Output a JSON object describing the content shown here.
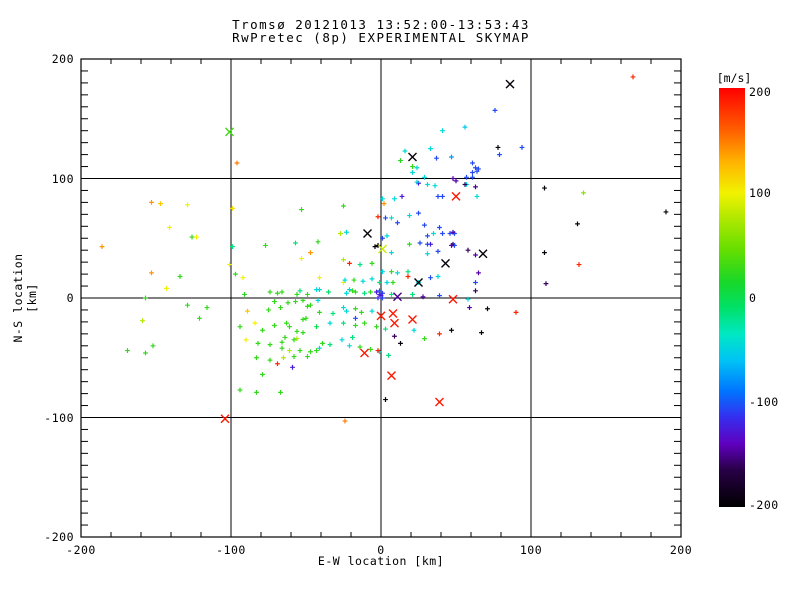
{
  "title": {
    "line1": "Tromsø 20121013 13:52:00-13:53:43",
    "line2": "RwPretec (8p) EXPERIMENTAL SKYMAP"
  },
  "axes": {
    "xlabel": "E-W location [km]",
    "ylabel": "N-S location [km]",
    "x_range": [
      -200,
      200
    ],
    "y_range": [
      -200,
      200
    ],
    "x_major_ticks": [
      -200,
      -100,
      0,
      100,
      200
    ],
    "y_major_ticks": [
      -200,
      -100,
      0,
      100,
      200
    ],
    "x_minor_step": 20,
    "y_minor_step": 10,
    "grid_at": [
      -100,
      0,
      100
    ],
    "frame_color": "#000000"
  },
  "colorbar": {
    "label": "[m/s]",
    "ticks": [
      200,
      100,
      0,
      -100,
      -200
    ],
    "range": [
      -200,
      200
    ]
  },
  "chart_data": {
    "type": "scatter",
    "title": "Tromsø 20121013 13:52:00-13:53:43 / RwPretec (8p) EXPERIMENTAL SKYMAP",
    "xlabel": "E-W location [km]",
    "ylabel": "N-S location [km]",
    "xlim": [
      -200,
      200
    ],
    "ylim": [
      -200,
      200
    ],
    "value_unit": "m/s",
    "value_range": [
      -200,
      200
    ],
    "colormap_stops": [
      [
        -200,
        0,
        0,
        0
      ],
      [
        -165,
        40,
        0,
        70
      ],
      [
        -140,
        95,
        0,
        190
      ],
      [
        -115,
        55,
        45,
        238
      ],
      [
        -90,
        0,
        115,
        255
      ],
      [
        -60,
        0,
        195,
        245
      ],
      [
        -35,
        0,
        232,
        195
      ],
      [
        -10,
        0,
        225,
        105
      ],
      [
        15,
        25,
        215,
        40
      ],
      [
        45,
        100,
        222,
        0
      ],
      [
        75,
        175,
        232,
        0
      ],
      [
        100,
        242,
        242,
        0
      ],
      [
        130,
        255,
        178,
        0
      ],
      [
        160,
        255,
        95,
        0
      ],
      [
        200,
        255,
        0,
        0
      ]
    ],
    "points_format": [
      "x_km",
      "y_km",
      "velocity_mps"
    ],
    "points": [
      [
        76,
        157,
        -105
      ],
      [
        56,
        143,
        -55
      ],
      [
        41,
        140,
        -45
      ],
      [
        16,
        123,
        -45
      ],
      [
        33,
        125,
        -45
      ],
      [
        37,
        117,
        -105
      ],
      [
        47,
        118,
        -75
      ],
      [
        13,
        115,
        20
      ],
      [
        78,
        126,
        -195
      ],
      [
        94,
        126,
        -105
      ],
      [
        79,
        120,
        -105
      ],
      [
        21,
        110,
        25
      ],
      [
        24,
        109,
        -45
      ],
      [
        21,
        105,
        -45
      ],
      [
        61,
        113,
        -105
      ],
      [
        63,
        109,
        -105
      ],
      [
        65,
        108,
        -105
      ],
      [
        61,
        101,
        -105
      ],
      [
        48,
        100,
        -145
      ],
      [
        57,
        101,
        -105
      ],
      [
        29,
        101,
        -45
      ],
      [
        25,
        96,
        -125
      ],
      [
        31,
        95,
        -45
      ],
      [
        36,
        94,
        -45
      ],
      [
        57,
        95,
        -45
      ],
      [
        38,
        85,
        -105
      ],
      [
        41,
        85,
        -105
      ],
      [
        63,
        93,
        -150
      ],
      [
        64,
        85,
        -45
      ],
      [
        64,
        106,
        -105
      ],
      [
        61,
        105,
        -105
      ],
      [
        24,
        97,
        -45
      ],
      [
        50,
        98,
        -145
      ],
      [
        56,
        95,
        -160
      ],
      [
        14,
        85,
        -125
      ],
      [
        9,
        83,
        -45
      ],
      [
        1,
        83,
        -45
      ],
      [
        25,
        71,
        -105
      ],
      [
        19,
        69,
        -45
      ],
      [
        29,
        61,
        -105
      ],
      [
        39,
        59,
        -105
      ],
      [
        3,
        67,
        -105
      ],
      [
        7,
        67,
        -45
      ],
      [
        11,
        63,
        -105
      ],
      [
        4,
        52,
        -45
      ],
      [
        1,
        50,
        -105
      ],
      [
        31,
        52,
        -105
      ],
      [
        33,
        45,
        -125
      ],
      [
        49,
        54,
        -105
      ],
      [
        48,
        45,
        -160
      ],
      [
        -2,
        44,
        -195
      ],
      [
        -25,
        77,
        25
      ],
      [
        -27,
        54,
        75
      ],
      [
        -2,
        68,
        185
      ],
      [
        2,
        79,
        140
      ],
      [
        35,
        54,
        -45
      ],
      [
        41,
        54,
        -105
      ],
      [
        46,
        54,
        -105
      ],
      [
        48,
        55,
        -145
      ],
      [
        49,
        44,
        -105
      ],
      [
        47,
        44,
        -145
      ],
      [
        63,
        13,
        -105
      ],
      [
        63,
        6,
        -160
      ],
      [
        65,
        21,
        -145
      ],
      [
        59,
        -8,
        -145
      ],
      [
        71,
        -9,
        -195
      ],
      [
        67,
        -29,
        -195
      ],
      [
        90,
        -12,
        185
      ],
      [
        110,
        12,
        -160
      ],
      [
        132,
        28,
        185
      ],
      [
        109,
        38,
        -195
      ],
      [
        131,
        62,
        -195
      ],
      [
        190,
        72,
        -195
      ],
      [
        135,
        88,
        60
      ],
      [
        109,
        92,
        -195
      ],
      [
        168,
        185,
        185
      ],
      [
        -96,
        113,
        150
      ],
      [
        -101,
        28,
        100
      ],
      [
        -4,
        43,
        -195
      ],
      [
        7,
        38,
        -45
      ],
      [
        19,
        45,
        25
      ],
      [
        26,
        46,
        -105
      ],
      [
        31,
        45,
        -105
      ],
      [
        38,
        39,
        -105
      ],
      [
        31,
        37,
        -45
      ],
      [
        58,
        40,
        -160
      ],
      [
        63,
        36,
        -145
      ],
      [
        -21,
        29,
        185
      ],
      [
        -6,
        29,
        25
      ],
      [
        -14,
        28,
        -15
      ],
      [
        1,
        22,
        -45
      ],
      [
        7,
        22,
        25
      ],
      [
        11,
        21,
        -45
      ],
      [
        18,
        22,
        -15
      ],
      [
        18,
        18,
        185
      ],
      [
        -25,
        13,
        100
      ],
      [
        -18,
        15,
        25
      ],
      [
        -12,
        14,
        -45
      ],
      [
        -6,
        16,
        -45
      ],
      [
        -1,
        13,
        -15
      ],
      [
        4,
        13,
        -45
      ],
      [
        8,
        13,
        25
      ],
      [
        25,
        13,
        -45
      ],
      [
        33,
        17,
        -105
      ],
      [
        38,
        18,
        -45
      ],
      [
        -23,
        4,
        -45
      ],
      [
        -17,
        5,
        25
      ],
      [
        -11,
        4,
        -15
      ],
      [
        -7,
        5,
        25
      ],
      [
        7,
        3,
        -15
      ],
      [
        21,
        3,
        -15
      ],
      [
        28,
        1,
        -145
      ],
      [
        39,
        2,
        -105
      ],
      [
        58,
        -1,
        -45
      ],
      [
        -3,
        5,
        -125
      ],
      [
        -1,
        3,
        -115
      ],
      [
        1,
        4,
        -110
      ],
      [
        -2,
        0,
        -120
      ],
      [
        1,
        0,
        -105
      ],
      [
        0,
        2,
        -130
      ],
      [
        -1,
        6,
        -100
      ],
      [
        -23,
        -11,
        -45
      ],
      [
        -17,
        -9,
        25
      ],
      [
        -13,
        -12,
        25
      ],
      [
        -6,
        -11,
        -45
      ],
      [
        -25,
        -21,
        -15
      ],
      [
        -17,
        -23,
        25
      ],
      [
        -11,
        -21,
        25
      ],
      [
        -3,
        -24,
        25
      ],
      [
        3,
        -26,
        -15
      ],
      [
        9,
        -32,
        -160
      ],
      [
        13,
        -38,
        -195
      ],
      [
        22,
        -27,
        -45
      ],
      [
        29,
        -34,
        25
      ],
      [
        39,
        -30,
        185
      ],
      [
        47,
        -27,
        -195
      ],
      [
        -21,
        -40,
        -45
      ],
      [
        -14,
        -41,
        25
      ],
      [
        -7,
        -43,
        25
      ],
      [
        -1,
        -45,
        -45
      ],
      [
        5,
        -48,
        -15
      ],
      [
        -2,
        -44,
        185
      ],
      [
        -17,
        -17,
        -105
      ],
      [
        -153,
        80,
        140
      ],
      [
        -147,
        79,
        120
      ],
      [
        -129,
        78,
        100
      ],
      [
        -141,
        59,
        100
      ],
      [
        -126,
        51,
        25
      ],
      [
        -123,
        51,
        100
      ],
      [
        -186,
        43,
        140
      ],
      [
        -99,
        75,
        110
      ],
      [
        -53,
        74,
        25
      ],
      [
        -77,
        44,
        25
      ],
      [
        -57,
        46,
        -15
      ],
      [
        -42,
        47,
        25
      ],
      [
        -153,
        21,
        140
      ],
      [
        -134,
        18,
        25
      ],
      [
        -143,
        8,
        100
      ],
      [
        -157,
        0,
        25
      ],
      [
        -129,
        -6,
        25
      ],
      [
        -116,
        -8,
        25
      ],
      [
        -121,
        -17,
        25
      ],
      [
        -159,
        -19,
        75
      ],
      [
        -169,
        -44,
        25
      ],
      [
        -157,
        -46,
        25
      ],
      [
        -152,
        -40,
        25
      ],
      [
        -99,
        43,
        -15
      ],
      [
        -53,
        33,
        100
      ],
      [
        -47,
        38,
        140
      ],
      [
        -41,
        17,
        100
      ],
      [
        -41,
        7,
        -45
      ],
      [
        -23,
        55,
        -45
      ],
      [
        -25,
        32,
        75
      ],
      [
        -21,
        7,
        -45
      ],
      [
        -24,
        15,
        -45
      ],
      [
        -97,
        20,
        25
      ],
      [
        -92,
        17,
        100
      ],
      [
        -66,
        5,
        25
      ],
      [
        -74,
        5,
        25
      ],
      [
        -71,
        -3,
        25
      ],
      [
        -62,
        -4,
        25
      ],
      [
        -56,
        3,
        25
      ],
      [
        -49,
        3,
        25
      ],
      [
        -43,
        7,
        -45
      ],
      [
        -52,
        -2,
        25
      ],
      [
        -49,
        -7,
        25
      ],
      [
        -41,
        -12,
        25
      ],
      [
        -52,
        -18,
        25
      ],
      [
        -61,
        -24,
        25
      ],
      [
        -56,
        -28,
        25
      ],
      [
        -64,
        -33,
        25
      ],
      [
        -56,
        -34,
        75
      ],
      [
        -52,
        -29,
        25
      ],
      [
        -43,
        -24,
        0
      ],
      [
        -34,
        -21,
        -45
      ],
      [
        -32,
        -13,
        -15
      ],
      [
        -25,
        -8,
        -45
      ],
      [
        -66,
        -42,
        25
      ],
      [
        -61,
        -44,
        75
      ],
      [
        -54,
        -44,
        25
      ],
      [
        -58,
        -49,
        25
      ],
      [
        -49,
        -49,
        25
      ],
      [
        -43,
        -44,
        25
      ],
      [
        -39,
        -38,
        25
      ],
      [
        -69,
        -55,
        185
      ],
      [
        -59,
        -58,
        -125
      ],
      [
        -79,
        -64,
        25
      ],
      [
        -83,
        -79,
        25
      ],
      [
        -67,
        -79,
        25
      ],
      [
        -94,
        -77,
        25
      ],
      [
        -91,
        3,
        20
      ],
      [
        -69,
        4,
        25
      ],
      [
        -54,
        6,
        -15
      ],
      [
        -35,
        5,
        -10
      ],
      [
        -19,
        6,
        25
      ],
      [
        -89,
        -11,
        120
      ],
      [
        -75,
        -10,
        25
      ],
      [
        -67,
        -8,
        25
      ],
      [
        -57,
        -3,
        25
      ],
      [
        -47,
        -6,
        25
      ],
      [
        -42,
        -2,
        -45
      ],
      [
        -94,
        -24,
        25
      ],
      [
        -84,
        -21,
        100
      ],
      [
        -79,
        -27,
        25
      ],
      [
        -71,
        -23,
        25
      ],
      [
        -63,
        -21,
        25
      ],
      [
        -50,
        -17,
        25
      ],
      [
        -90,
        -35,
        100
      ],
      [
        -82,
        -38,
        25
      ],
      [
        -74,
        -39,
        25
      ],
      [
        -66,
        -37,
        25
      ],
      [
        -58,
        -35,
        25
      ],
      [
        -83,
        -50,
        25
      ],
      [
        -74,
        -52,
        25
      ],
      [
        -65,
        -50,
        75
      ],
      [
        -47,
        -45,
        25
      ],
      [
        -41,
        -42,
        -45
      ],
      [
        -34,
        -39,
        -15
      ],
      [
        -26,
        -35,
        -45
      ],
      [
        -19,
        -33,
        -15
      ],
      [
        -24,
        -103,
        150
      ],
      [
        3,
        -85,
        -195
      ]
    ],
    "x_markers_format": [
      "x_km",
      "y_km",
      "velocity_mps"
    ],
    "x_markers": [
      [
        -104,
        -101,
        190
      ],
      [
        50,
        85,
        190
      ],
      [
        0,
        -15,
        190
      ],
      [
        8,
        -13,
        190
      ],
      [
        9,
        -21,
        190
      ],
      [
        21,
        -18,
        190
      ],
      [
        48,
        -1,
        190
      ],
      [
        -11,
        -46,
        190
      ],
      [
        7,
        -65,
        190
      ],
      [
        39,
        -87,
        190
      ],
      [
        86,
        179,
        -195
      ],
      [
        21,
        118,
        -195
      ],
      [
        -9,
        54,
        -195
      ],
      [
        43,
        29,
        -195
      ],
      [
        68,
        37,
        -195
      ],
      [
        25,
        13,
        -195
      ],
      [
        11,
        1,
        -150
      ],
      [
        1,
        41,
        85
      ],
      [
        -101,
        139,
        30
      ]
    ]
  }
}
